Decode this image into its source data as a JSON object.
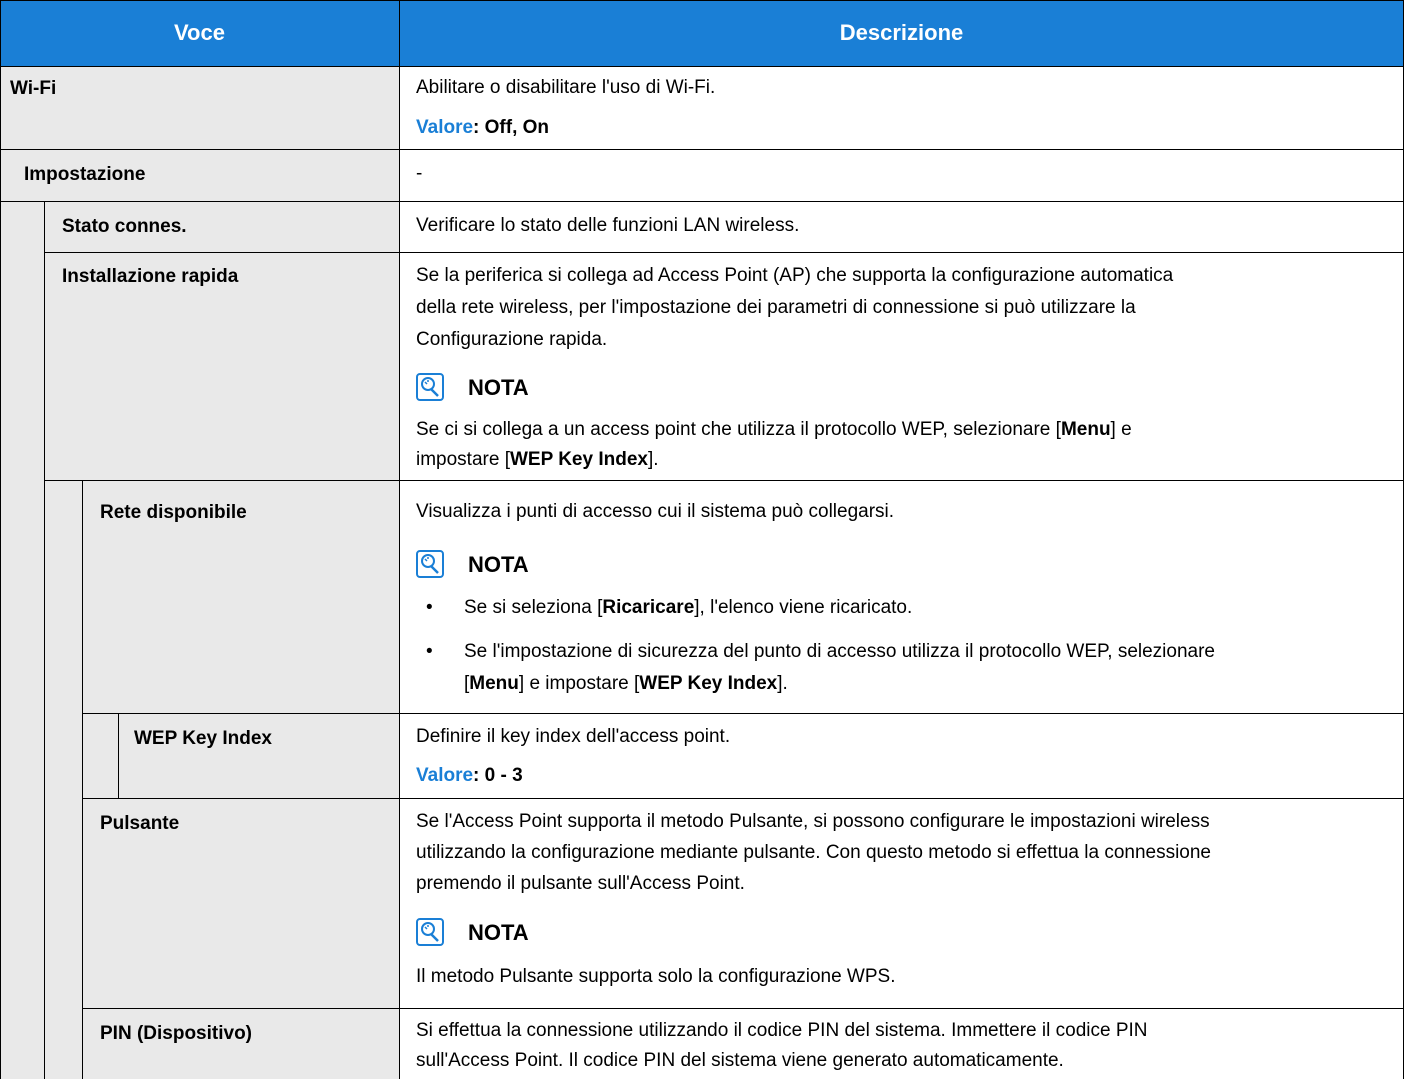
{
  "header": {
    "voce": "Voce",
    "descrizione": "Descrizione"
  },
  "rows": {
    "wifi": {
      "label": "Wi-Fi",
      "desc": "Abilitare o disabilitare l'uso di Wi-Fi.",
      "valore_key": "Valore",
      "valore_val": ": Off, On"
    },
    "impostazione": {
      "label": "Impostazione",
      "desc": "-"
    },
    "stato": {
      "label": "Stato connes.",
      "desc": "Verificare lo stato delle funzioni LAN wireless."
    },
    "installazione": {
      "label": "Installazione rapida",
      "desc_l1": "Se la periferica si collega ad Access Point (AP) che supporta la configurazione automatica",
      "desc_l2": "della rete wireless, per l'impostazione dei parametri di connessione si può utilizzare la",
      "desc_l3": "Configurazione rapida.",
      "nota": "NOTA",
      "nota_l1_a": "Se ci si collega a un access point che utilizza il protocollo WEP, selezionare [",
      "nota_l1_b": "Menu",
      "nota_l1_c": "] e",
      "nota_l2_a": "impostare [",
      "nota_l2_b": "WEP Key Index",
      "nota_l2_c": "]."
    },
    "rete": {
      "label": "Rete disponibile",
      "desc": "Visualizza i punti di accesso cui il sistema può collegarsi.",
      "nota": "NOTA",
      "bullet_char": "•",
      "b1_a": "Se si seleziona [",
      "b1_b": "Ricaricare",
      "b1_c": "], l'elenco viene ricaricato.",
      "b2_l1": "Se l'impostazione di sicurezza del punto di accesso utilizza il protocollo WEP, selezionare",
      "b2_l2_a": "[",
      "b2_l2_b": "Menu",
      "b2_l2_c": "] e impostare [",
      "b2_l2_d": "WEP Key Index",
      "b2_l2_e": "]."
    },
    "wep": {
      "label": "WEP Key Index",
      "desc": "Definire il key index dell'access point.",
      "valore_key": "Valore",
      "valore_val": ": 0 - 3"
    },
    "pulsante": {
      "label": "Pulsante",
      "desc_l1": "Se l'Access Point supporta il metodo Pulsante, si possono configurare le impostazioni wireless",
      "desc_l2": "utilizzando la configurazione mediante pulsante. Con questo metodo si effettua la connessione",
      "desc_l3": "premendo il pulsante sull'Access Point.",
      "nota": "NOTA",
      "nota_text": "Il metodo Pulsante supporta solo la configurazione WPS."
    },
    "pin": {
      "label": "PIN (Dispositivo)",
      "desc_l1": "Si effettua la connessione utilizzando il codice PIN del sistema. Immettere il codice PIN",
      "desc_l2": "sull'Access Point. Il codice PIN del sistema viene generato automaticamente."
    }
  },
  "colors": {
    "header_bg": "#1a7fd6",
    "accent": "#1a7fd6",
    "shade": "#e9e9e9"
  },
  "icons": {
    "nota": "lightbulb-note-icon"
  }
}
